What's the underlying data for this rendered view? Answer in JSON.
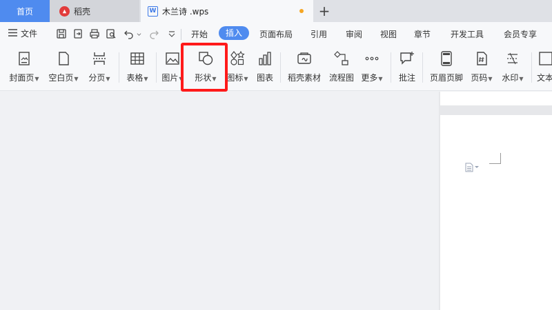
{
  "tabs": {
    "home": "首页",
    "docer": "稻壳",
    "document": "木兰诗 .wps"
  },
  "menu": {
    "file": "文件",
    "tabs": [
      {
        "label": "开始",
        "active": false
      },
      {
        "label": "插入",
        "active": true
      },
      {
        "label": "页面布局",
        "active": false
      },
      {
        "label": "引用",
        "active": false
      },
      {
        "label": "审阅",
        "active": false
      },
      {
        "label": "视图",
        "active": false
      },
      {
        "label": "章节",
        "active": false
      },
      {
        "label": "开发工具",
        "active": false
      },
      {
        "label": "会员专享",
        "active": false
      }
    ]
  },
  "ribbon": {
    "cover": "封面页",
    "blank": "空白页",
    "page_break": "分页",
    "table": "表格",
    "picture": "图片",
    "shape": "形状",
    "icon": "图标",
    "chart": "图表",
    "docer_material": "稻壳素材",
    "flowchart": "流程图",
    "more": "更多",
    "comment": "批注",
    "header_footer": "页眉页脚",
    "page_number": "页码",
    "watermark": "水印",
    "text": "文本"
  },
  "colors": {
    "accent": "#4f8bef",
    "highlight": "#ff1a1a"
  }
}
